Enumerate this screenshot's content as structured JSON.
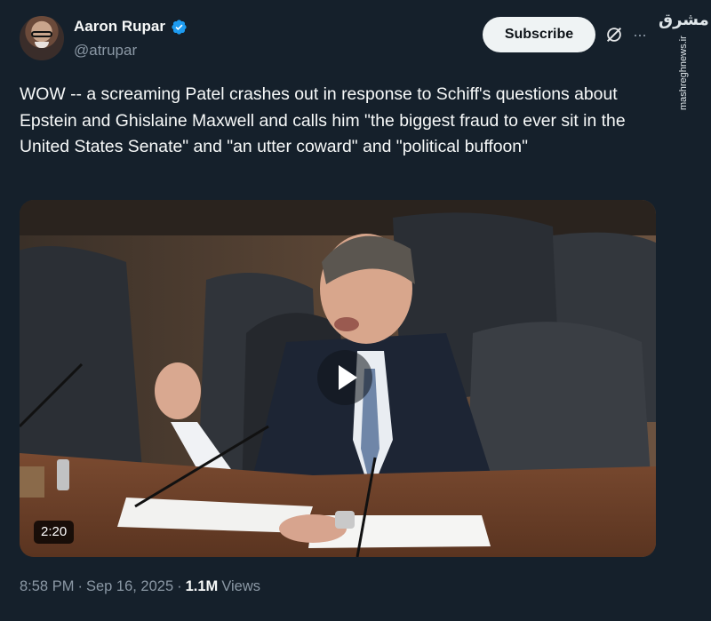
{
  "author": {
    "display_name": "Aaron Rupar",
    "handle": "@atrupar"
  },
  "header": {
    "subscribe_label": "Subscribe"
  },
  "watermark": {
    "logo_text": "مشرق",
    "site": "mashreghnews.ir"
  },
  "tweet": {
    "text": "WOW -- a screaming Patel crashes out in response to Schiff's questions about Epstein and Ghislaine Maxwell and calls him \"the biggest fraud to ever sit in the United States Senate\" and \"an utter coward\" and \"political buffoon\""
  },
  "media": {
    "duration": "2:20"
  },
  "meta": {
    "time": "8:58 PM",
    "date_separator": "·",
    "date": "Sep 16, 2025",
    "views_separator": "·",
    "views_count": "1.1M",
    "views_label": "Views"
  },
  "icons": {
    "verified": "verified-badge-icon",
    "grok": "grok-icon",
    "more": "more-dots-icon",
    "play": "play-icon"
  },
  "colors": {
    "background": "#15202b",
    "accent": "#1d9bf0",
    "secondary_text": "#8b98a5",
    "primary_text": "#f7f9f9"
  }
}
